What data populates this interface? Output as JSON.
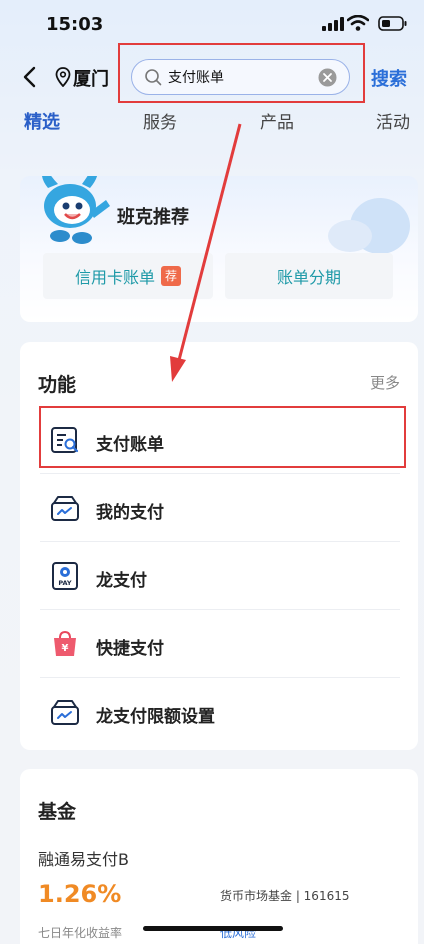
{
  "status_bar": {
    "time": "15:03"
  },
  "header": {
    "city": "厦门",
    "search_value": "支付账单",
    "search_button": "搜索"
  },
  "tabs": [
    {
      "label": "精选",
      "active": true
    },
    {
      "label": "服务",
      "active": false
    },
    {
      "label": "产品",
      "active": false
    },
    {
      "label": "活动",
      "active": false
    }
  ],
  "banner": {
    "title": "班克推荐",
    "buttons": [
      {
        "label": "信用卡账单",
        "tag": "荐"
      },
      {
        "label": "账单分期"
      }
    ]
  },
  "functions": {
    "title": "功能",
    "more": "更多",
    "items": [
      {
        "label": "支付账单",
        "icon": "bill-search-icon"
      },
      {
        "label": "我的支付",
        "icon": "wallet-icon"
      },
      {
        "label": "龙支付",
        "icon": "long-pay-icon"
      },
      {
        "label": "快捷支付",
        "icon": "quick-pay-bag-icon"
      },
      {
        "label": "龙支付限额设置",
        "icon": "limit-wallet-icon"
      }
    ]
  },
  "fund": {
    "title": "基金",
    "name": "融通易支付B",
    "rate": "1.26%",
    "type": "货币市场基金 | 161615",
    "rate_label": "七日年化收益率",
    "risk": "低风险"
  },
  "colors": {
    "accent": "#2a6ed8",
    "highlight_box": "#e23c3c",
    "fund_rate": "#f08a24",
    "teal_text": "#1f9aa8"
  }
}
